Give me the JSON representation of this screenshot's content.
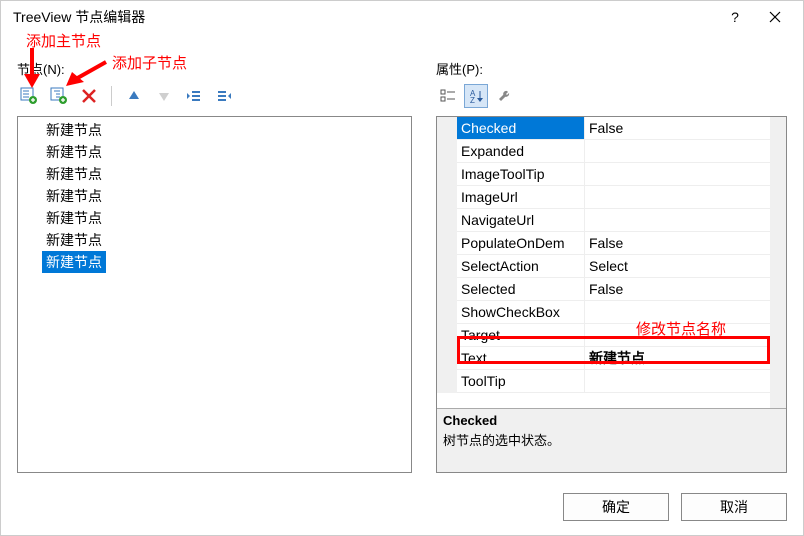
{
  "window": {
    "title": "TreeView 节点编辑器"
  },
  "annotations": {
    "addRoot": "添加主节点",
    "addChild": "添加子节点",
    "editText": "修改节点名称"
  },
  "leftLabel": "节点(N):",
  "rightLabel": "属性(P):",
  "treeItems": [
    {
      "label": "新建节点"
    },
    {
      "label": "新建节点"
    },
    {
      "label": "新建节点"
    },
    {
      "label": "新建节点"
    },
    {
      "label": "新建节点"
    },
    {
      "label": "新建节点"
    },
    {
      "label": "新建节点",
      "selected": true
    }
  ],
  "properties": [
    {
      "name": "Checked",
      "value": "False",
      "selected": true
    },
    {
      "name": "Expanded",
      "value": ""
    },
    {
      "name": "ImageToolTip",
      "value": ""
    },
    {
      "name": "ImageUrl",
      "value": ""
    },
    {
      "name": "NavigateUrl",
      "value": ""
    },
    {
      "name": "PopulateOnDem",
      "value": "False"
    },
    {
      "name": "SelectAction",
      "value": "Select"
    },
    {
      "name": "Selected",
      "value": "False"
    },
    {
      "name": "ShowCheckBox",
      "value": ""
    },
    {
      "name": "Target",
      "value": ""
    },
    {
      "name": "Text",
      "value": "新建节点",
      "textRow": true
    },
    {
      "name": "ToolTip",
      "value": ""
    }
  ],
  "description": {
    "name": "Checked",
    "text": "树节点的选中状态。"
  },
  "buttons": {
    "ok": "确定",
    "cancel": "取消"
  }
}
